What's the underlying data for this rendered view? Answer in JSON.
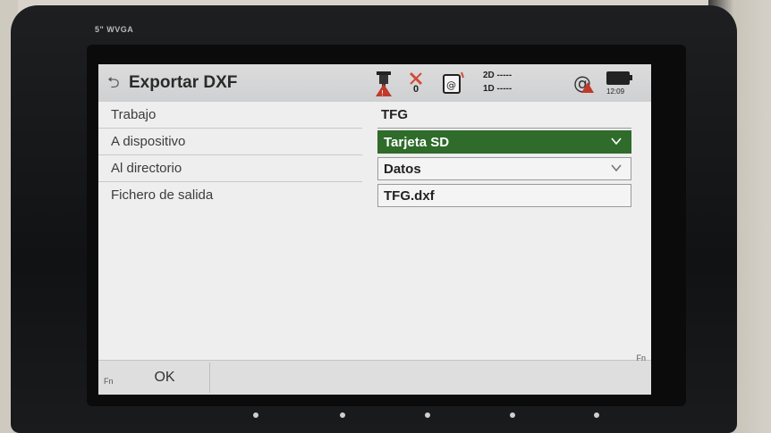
{
  "device": {
    "label": "5\" WVGA"
  },
  "header": {
    "title": "Exportar DXF",
    "sat_count": "0",
    "quality_2d": "2D -----",
    "quality_1d": "1D -----",
    "clock": "12:09"
  },
  "form": {
    "rows": [
      {
        "label": "Trabajo",
        "value": "TFG"
      },
      {
        "label": "A dispositivo",
        "value": "Tarjeta SD"
      },
      {
        "label": "Al directorio",
        "value": "Datos"
      },
      {
        "label": "Fichero de salida",
        "value": "TFG.dxf"
      }
    ]
  },
  "softkeys": {
    "fn_left": "Fn",
    "ok": "OK",
    "fn_right": "Fn"
  },
  "colors": {
    "selected_field": "#2f6b2a",
    "screen_bg": "#eeeeee"
  },
  "icons": [
    "back-icon",
    "total-station-icon",
    "satellite-icon",
    "radio-icon",
    "at-icon",
    "battery-icon",
    "chevron-down-icon"
  ]
}
